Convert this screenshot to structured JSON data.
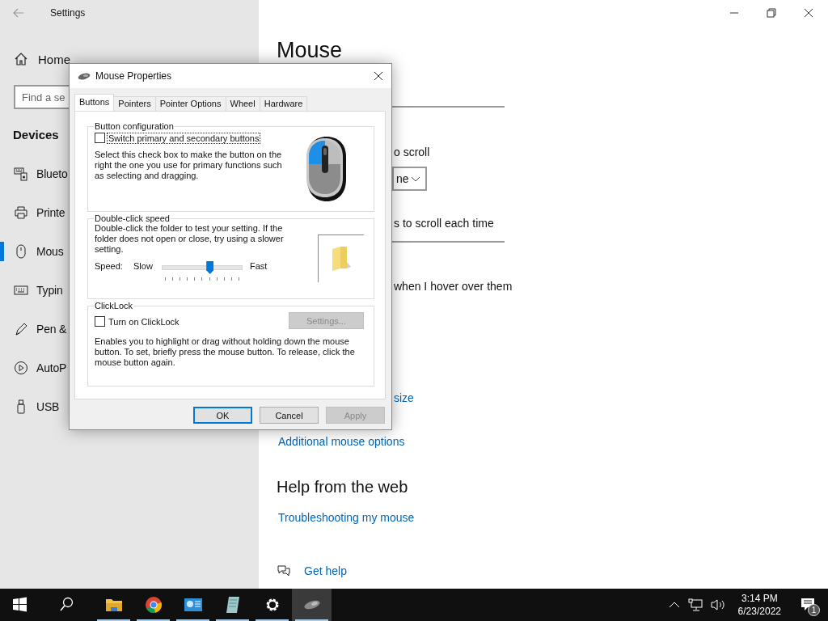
{
  "settings_window": {
    "title": "Settings",
    "nav": {
      "home": "Home",
      "search": {
        "placeholder": "Find a se"
      },
      "section": "Devices",
      "items": [
        {
          "label": "Blueto",
          "kind": "bluetooth",
          "selected": false
        },
        {
          "label": "Printe",
          "kind": "printer",
          "selected": false
        },
        {
          "label": "Mous",
          "kind": "mouse",
          "selected": true
        },
        {
          "label": "Typin",
          "kind": "keyboard",
          "selected": false
        },
        {
          "label": "Pen &",
          "kind": "pen",
          "selected": false
        },
        {
          "label": "AutoP",
          "kind": "autoplay",
          "selected": false
        },
        {
          "label": "USB",
          "kind": "usb",
          "selected": false
        }
      ]
    },
    "main": {
      "heading": "Mouse",
      "scroll_label": "o scroll",
      "scroll_dropdown": {
        "value": "ne"
      },
      "lines_label": "s to scroll each time",
      "hover_label": "when I hover over them",
      "links": [
        "size",
        "Additional mouse options"
      ],
      "help_heading": "Help from the web",
      "help_links": [
        "Troubleshooting my mouse"
      ],
      "get_help": "Get help"
    }
  },
  "dialog": {
    "title": "Mouse Properties",
    "tabs": [
      {
        "label": "Buttons",
        "selected": true
      },
      {
        "label": "Pointers",
        "selected": false
      },
      {
        "label": "Pointer Options",
        "selected": false
      },
      {
        "label": "Wheel",
        "selected": false
      },
      {
        "label": "Hardware",
        "selected": false
      }
    ],
    "button_configuration": {
      "title": "Button configuration",
      "checkbox": {
        "label": "Switch primary and secondary buttons",
        "checked": false,
        "focused": true
      },
      "description": "Select this check box to make the button on the right the one you use for primary functions such as selecting and dragging."
    },
    "double_click": {
      "title": "Double-click speed",
      "description": "Double-click the folder to test your setting. If the folder does not open or close, try using a slower setting.",
      "speed_label": "Speed:",
      "slow": "Slow",
      "fast": "Fast",
      "slider": {
        "level": 0.6
      }
    },
    "clicklock": {
      "title": "ClickLock",
      "checkbox": {
        "label": "Turn on ClickLock",
        "checked": false,
        "focused": false
      },
      "settings_button": {
        "label": "Settings...",
        "disabled": true
      },
      "description": "Enables you to highlight or drag without holding down the mouse button. To set, briefly press the mouse button. To release, click the mouse button again."
    },
    "buttons": [
      {
        "label": "OK",
        "default": true,
        "disabled": false
      },
      {
        "label": "Cancel",
        "default": false,
        "disabled": false
      },
      {
        "label": "Apply",
        "default": false,
        "disabled": true
      }
    ]
  },
  "taskbar": {
    "apps": [
      {
        "kind": "folder",
        "running": true,
        "selected": false
      },
      {
        "kind": "chrome",
        "running": true,
        "selected": false
      },
      {
        "kind": "control-panel",
        "running": true,
        "selected": false
      },
      {
        "kind": "notepad",
        "running": true,
        "selected": false
      },
      {
        "kind": "settings",
        "running": true,
        "selected": false
      },
      {
        "kind": "mouse",
        "running": true,
        "selected": true
      }
    ],
    "time": "3:14 PM",
    "date": "6/23/2022",
    "notification_count": "1"
  }
}
